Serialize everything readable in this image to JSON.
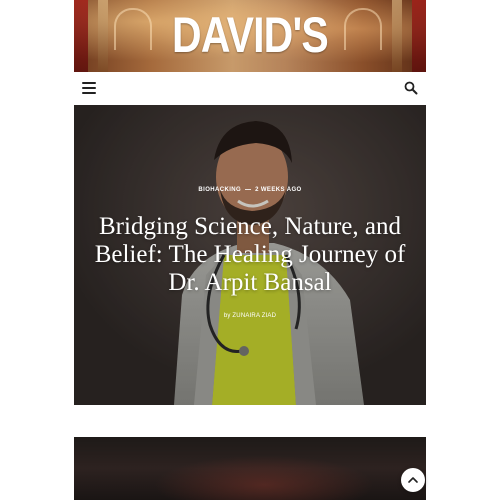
{
  "header": {
    "brand": "DAVID'S GUIDE"
  },
  "nav": {
    "menu_icon": "hamburger-menu-icon",
    "search_icon": "search-icon"
  },
  "hero": {
    "category": "BIOHACKING",
    "time": "2 WEEKS AGO",
    "title": "Bridging Science, Nature, and Belief: The Healing Journey of Dr. Arpit Bansal",
    "author": "by ZUNAIRA ZIAD"
  },
  "scroll_top": {
    "icon": "chevron-up-icon"
  }
}
